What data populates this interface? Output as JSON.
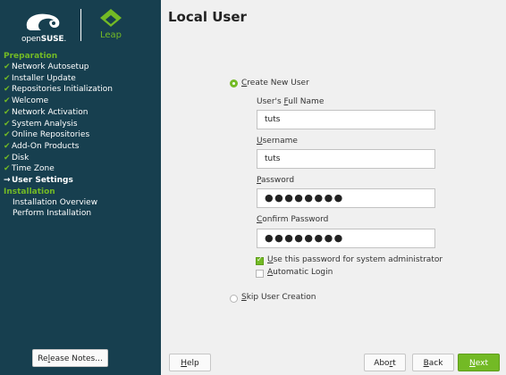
{
  "branding": {
    "opensuse_prefix": "open",
    "opensuse_name": "SUSE",
    "opensuse_suffix": ".",
    "leap_text": "Leap"
  },
  "sidebar": {
    "preparation_header": "Preparation",
    "preparation_steps": [
      {
        "label": "Network Autosetup",
        "mark": "✔"
      },
      {
        "label": "Installer Update",
        "mark": "✔"
      },
      {
        "label": "Repositories Initialization",
        "mark": "✔"
      },
      {
        "label": "Welcome",
        "mark": "✔"
      },
      {
        "label": "Network Activation",
        "mark": "✔"
      },
      {
        "label": "System Analysis",
        "mark": "✔"
      },
      {
        "label": "Online Repositories",
        "mark": "✔"
      },
      {
        "label": "Add-On Products",
        "mark": "✔"
      },
      {
        "label": "Disk",
        "mark": "✔"
      },
      {
        "label": "Time Zone",
        "mark": "✔"
      },
      {
        "label": "User Settings",
        "mark": "→"
      }
    ],
    "installation_header": "Installation",
    "installation_steps": [
      {
        "label": "Installation Overview"
      },
      {
        "label": "Perform Installation"
      }
    ],
    "release_notes_pre": "Re",
    "release_notes_u": "l",
    "release_notes_post": "ease Notes..."
  },
  "main": {
    "title": "Local User",
    "create_user": {
      "pre": "",
      "u": "C",
      "post": "reate New User",
      "selected": true
    },
    "full_name": {
      "pre": "User's ",
      "u": "F",
      "post": "ull Name",
      "value": "tuts"
    },
    "username": {
      "pre": "",
      "u": "U",
      "post": "sername",
      "value": "tuts"
    },
    "password": {
      "pre": "",
      "u": "P",
      "post": "assword",
      "value": "●●●●●●●●"
    },
    "confirm_password": {
      "pre": "",
      "u": "C",
      "post": "onfirm Password",
      "value": "●●●●●●●●"
    },
    "use_for_admin": {
      "pre": "",
      "u": "U",
      "post": "se this password for system administrator",
      "checked": true
    },
    "auto_login": {
      "pre": "",
      "u": "A",
      "post": "utomatic Login",
      "checked": false
    },
    "skip_user": {
      "pre": "",
      "u": "S",
      "post": "kip User Creation",
      "selected": false
    }
  },
  "footer": {
    "help": {
      "pre": "",
      "u": "H",
      "post": "elp"
    },
    "abort": {
      "pre": "Abo",
      "u": "r",
      "post": "t"
    },
    "back": {
      "pre": "",
      "u": "B",
      "post": "ack"
    },
    "next": {
      "pre": "",
      "u": "N",
      "post": "ext"
    }
  },
  "colors": {
    "sidebar_bg": "#173f4f",
    "accent_green": "#73ba25",
    "main_bg": "#f0f0f0"
  }
}
